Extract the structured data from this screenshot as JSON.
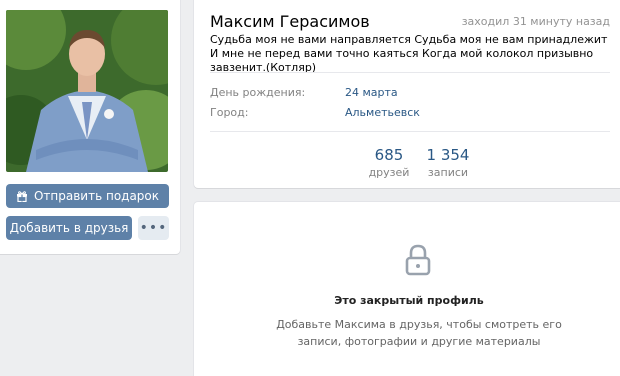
{
  "profile": {
    "name": "Максим Герасимов",
    "last_seen": "заходил 31 минуту назад",
    "status": "Судьба моя не вами направляется Судьба моя не вам принадлежит И мне не перед вами точно каяться Когда мой колокол призывно завзенит.(Котляр)"
  },
  "info": {
    "birthday_label": "День рождения:",
    "birthday_value": "24 марта",
    "city_label": "Город:",
    "city_value": "Альметьевск"
  },
  "counters": {
    "friends_count": "685",
    "friends_label": "друзей",
    "posts_count": "1 354",
    "posts_label": "записи"
  },
  "actions": {
    "gift_label": "Отправить подарок",
    "add_friend_label": "Добавить в друзья",
    "more_label": "•••"
  },
  "private": {
    "title": "Это закрытый профиль",
    "description": "Добавьте Максима в друзья, чтобы смотреть его записи, фотографии и другие материалы"
  },
  "icons": {
    "gift": "gift-icon",
    "lock": "lock-icon",
    "more": "more-icon"
  },
  "colors": {
    "accent": "#5e81a8",
    "link": "#2a5885",
    "background": "#edeef0"
  }
}
